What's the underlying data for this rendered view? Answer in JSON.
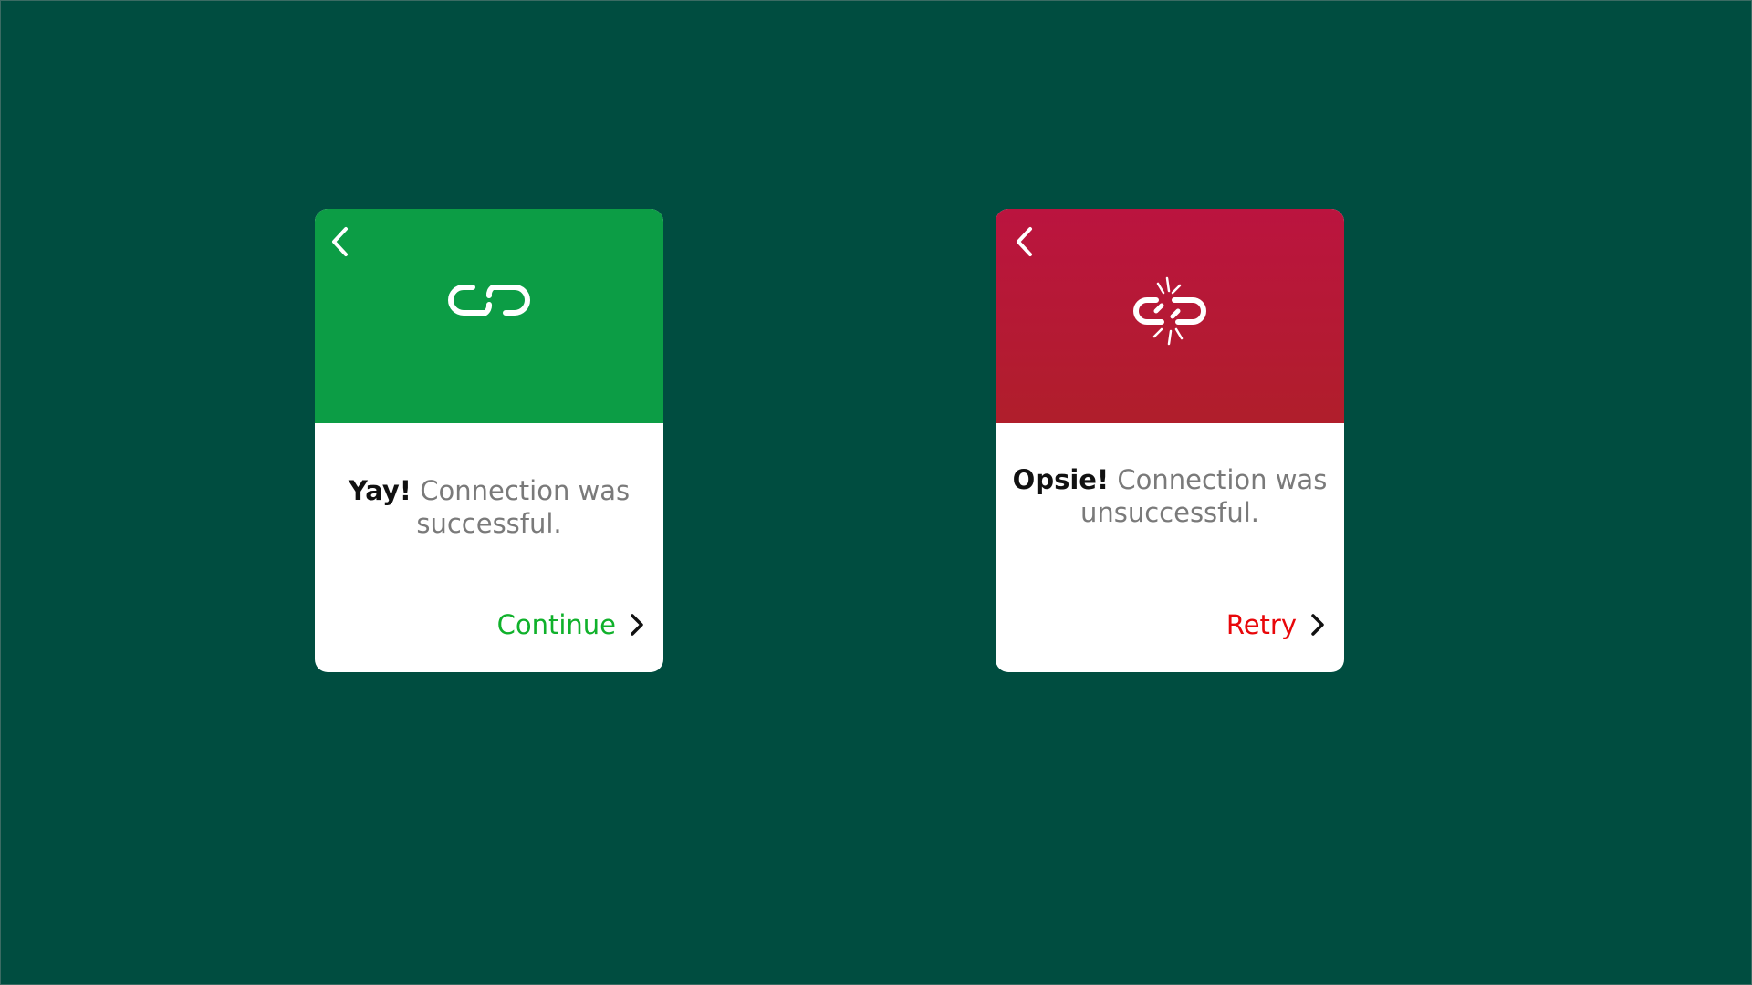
{
  "success_card": {
    "lead": "Yay!",
    "message": "Connection was successful.",
    "action_label": "Continue",
    "header_color": "#0c9d45",
    "action_color": "#10b12b",
    "icon": "link-icon",
    "back_icon": "chevron-left-icon"
  },
  "failure_card": {
    "lead": "Opsie!",
    "message": "Connection was unsuccessful.",
    "action_label": "Retry",
    "header_color": "#bb143f",
    "action_color": "#e8070a",
    "icon": "broken-link-icon",
    "back_icon": "chevron-left-icon"
  },
  "background_color": "#004d40"
}
